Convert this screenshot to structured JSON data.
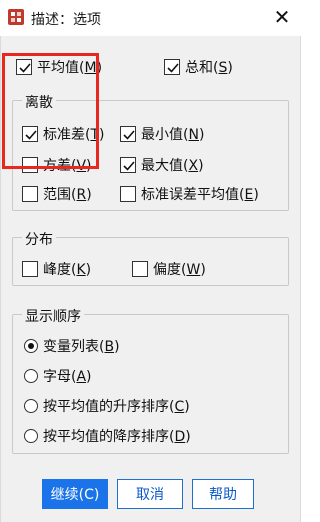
{
  "window": {
    "title": "描述：选项",
    "close_glyph": "✕",
    "icon": "spss-dialog-icon"
  },
  "top_options": [
    {
      "text": "平均值(",
      "mnemonic": "M",
      "suffix": ")",
      "checked": true
    },
    {
      "text": "总和(",
      "mnemonic": "S",
      "suffix": ")",
      "checked": true
    }
  ],
  "dispersion": {
    "legend": "离散",
    "items": [
      {
        "text": "标准差(",
        "mnemonic": "T",
        "suffix": ")",
        "checked": true
      },
      {
        "text": "最小值(",
        "mnemonic": "N",
        "suffix": ")",
        "checked": true
      },
      {
        "text": "方差(",
        "mnemonic": "V",
        "suffix": ")",
        "checked": false
      },
      {
        "text": "最大值(",
        "mnemonic": "X",
        "suffix": ")",
        "checked": true
      },
      {
        "text": "范围(",
        "mnemonic": "R",
        "suffix": ")",
        "checked": false
      },
      {
        "text": "标准误差平均值(",
        "mnemonic": "E",
        "suffix": ")",
        "checked": false
      }
    ]
  },
  "distribution": {
    "legend": "分布",
    "items": [
      {
        "text": "峰度(",
        "mnemonic": "K",
        "suffix": ")",
        "checked": false
      },
      {
        "text": "偏度(",
        "mnemonic": "W",
        "suffix": ")",
        "checked": false
      }
    ]
  },
  "display_order": {
    "legend": "显示顺序",
    "options": [
      {
        "text": "变量列表(",
        "mnemonic": "B",
        "suffix": ")",
        "selected": true
      },
      {
        "text": "字母(",
        "mnemonic": "A",
        "suffix": ")",
        "selected": false
      },
      {
        "text": "按平均值的升序排序(",
        "mnemonic": "C",
        "suffix": ")",
        "selected": false
      },
      {
        "text": "按平均值的降序排序(",
        "mnemonic": "D",
        "suffix": ")",
        "selected": false
      }
    ]
  },
  "buttons": {
    "continue": "继续(C)",
    "cancel": "取消",
    "help": "帮助"
  },
  "colors": {
    "highlight_box": "#e8281e",
    "primary_button": "#1a73e8"
  }
}
